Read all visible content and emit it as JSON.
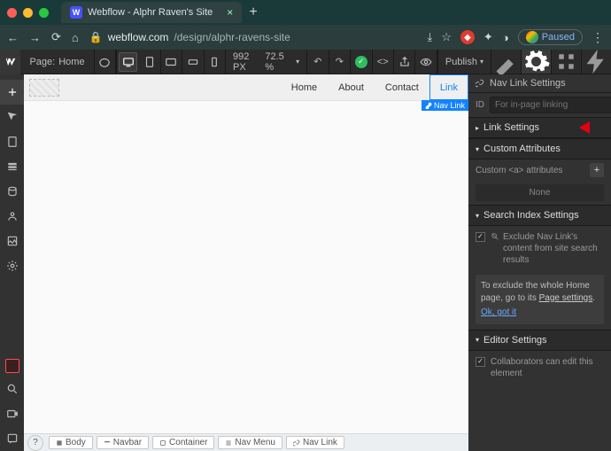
{
  "browser": {
    "tab_title": "Webflow - Alphr Raven's Site",
    "url_host": "webflow.com",
    "url_path": "/design/alphr-ravens-site",
    "paused_label": "Paused"
  },
  "toolbar": {
    "page_label": "Page:",
    "page_name": "Home",
    "width_px": "992 PX",
    "zoom": "72.5 %",
    "publish_label": "Publish"
  },
  "canvas_nav": {
    "items": [
      "Home",
      "About",
      "Contact",
      "Link"
    ],
    "selected_index": 3,
    "selected_tag": "Nav Link"
  },
  "breadcrumbs": [
    "Body",
    "Navbar",
    "Container",
    "Nav Menu",
    "Nav Link"
  ],
  "panel": {
    "sections": {
      "nav_link_settings": "Nav Link Settings",
      "link_settings": "Link Settings",
      "custom_attributes": "Custom Attributes",
      "search_index": "Search Index Settings",
      "editor_settings": "Editor Settings"
    },
    "id_label": "ID",
    "id_placeholder": "For in-page linking",
    "custom_attr_label": "Custom <a> attributes",
    "custom_attr_none": "None",
    "exclude_label": "Exclude Nav Link's content from site search results",
    "info_text_1": "To exclude the whole Home page, go to its ",
    "info_link": "Page settings",
    "info_text_2": ".",
    "info_ok": "Ok, got it",
    "collab_label": "Collaborators can edit this element"
  }
}
